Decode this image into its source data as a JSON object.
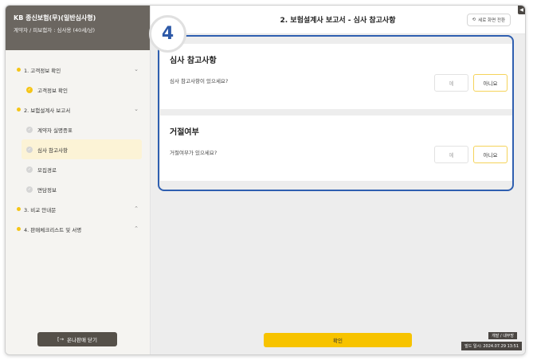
{
  "sidebar": {
    "title": "KB 종신보험(무)(일반심사형)",
    "subtitle": "계약자 / 피보험자 : 심사용 (40세/남)",
    "sections": [
      {
        "label": "1. 고객정보 확인",
        "chevron": "⌄",
        "items": [
          {
            "label": "고객정보 확인",
            "state": "done"
          }
        ]
      },
      {
        "label": "2. 보험설계사 보고서",
        "chevron": "⌄",
        "items": [
          {
            "label": "계약자 실명증표",
            "state": "todo"
          },
          {
            "label": "심사 참고사항",
            "state": "active"
          },
          {
            "label": "모집경로",
            "state": "todo"
          },
          {
            "label": "면담정보",
            "state": "todo"
          }
        ]
      },
      {
        "label": "3. 비교 안내문",
        "chevron": "⌃",
        "items": []
      },
      {
        "label": "4. 판매체크리스트 및 서명",
        "chevron": "⌃",
        "items": []
      }
    ],
    "close_label": "온나판매 닫기",
    "close_icon": "[→"
  },
  "header": {
    "title": "2. 보험설계사 보고서 - 심사 참고사항",
    "switch_label": "세로 화면 전환",
    "switch_icon": "⟲",
    "corner_icon": "◀"
  },
  "step_badge": "4",
  "cards": [
    {
      "title": "심사 참고사항",
      "question": "심사 참고사항이 있으세요?",
      "yes_label": "예",
      "no_label": "아니요"
    },
    {
      "title": "거절여부",
      "question": "거절여부가 있으세요?",
      "yes_label": "예",
      "no_label": "아니요"
    }
  ],
  "footer": {
    "confirm_label": "확인",
    "env_label": "개발 / 내부망",
    "build_label": "빌드 일시: 2024.07.29 13:51"
  },
  "colors": {
    "accent": "#f7c300",
    "highlight": "#2f5fb0",
    "sidebar_header": "#6b6660"
  }
}
